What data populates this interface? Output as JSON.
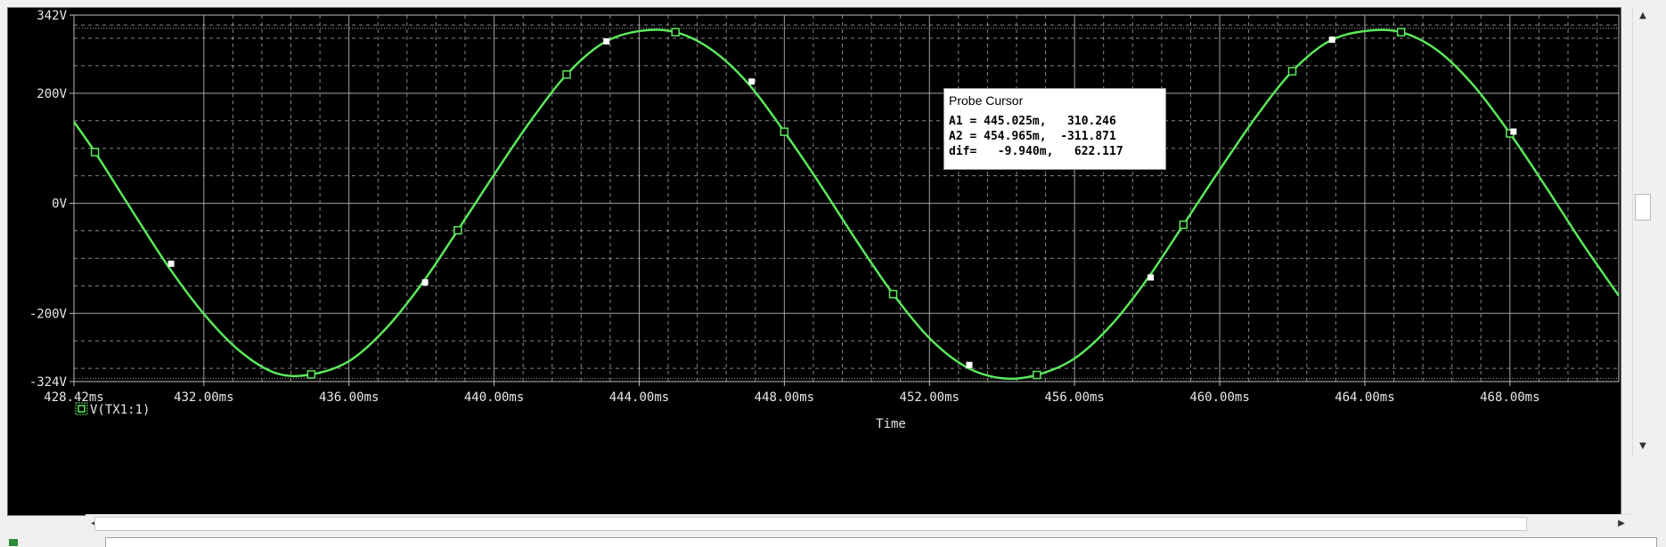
{
  "colors": {
    "background": "#000000",
    "trace": "#5be85b",
    "grid": "#bdbdbd",
    "text": "#e8e8e8"
  },
  "chart_data": {
    "type": "line",
    "title": "",
    "xlabel": "Time",
    "ylabel": "",
    "xlim": [
      428.42,
      471.0
    ],
    "ylim": [
      -324,
      342
    ],
    "x_tick_labels": [
      "428.42ms",
      "432.00ms",
      "436.00ms",
      "440.00ms",
      "444.00ms",
      "448.00ms",
      "452.00ms",
      "456.00ms",
      "460.00ms",
      "464.00ms",
      "468.00ms"
    ],
    "x_ticks": [
      428.42,
      432,
      436,
      440,
      444,
      448,
      452,
      456,
      460,
      464,
      468
    ],
    "y_tick_labels": [
      "342V",
      "200V",
      "0V",
      "-200V",
      "-324V"
    ],
    "y_ticks": [
      342,
      200,
      0,
      -200,
      -324
    ],
    "grid": true,
    "series": [
      {
        "name": "V(TX1:1)",
        "marker": "square",
        "x": [
          428.42,
          429.0,
          430.0,
          431.0,
          432.0,
          433.0,
          434.0,
          434.96,
          436.0,
          437.0,
          438.0,
          439.0,
          440.0,
          441.0,
          442.0,
          443.0,
          444.0,
          445.0,
          446.0,
          447.0,
          448.0,
          449.0,
          450.0,
          451.0,
          452.0,
          453.0,
          454.0,
          454.96,
          456.0,
          457.0,
          458.0,
          459.0,
          460.0,
          461.0,
          462.0,
          463.0,
          464.0,
          465.0,
          466.0,
          467.0,
          468.0,
          469.0,
          470.0,
          471.0
        ],
        "values": [
          148,
          93,
          -11,
          -113,
          -201,
          -269,
          -309,
          -311,
          -287,
          -229,
          -147,
          -49,
          52,
          149,
          234,
          291,
          313,
          311,
          279,
          218,
          130,
          33,
          -69,
          -165,
          -245,
          -297,
          -318,
          -312,
          -282,
          -222,
          -138,
          -39,
          61,
          157,
          240,
          294,
          313,
          311,
          278,
          214,
          127,
          29,
          -73,
          -168
        ]
      }
    ],
    "legend": {
      "entries": [
        "V(TX1:1)"
      ],
      "placement": "bottom-left"
    }
  },
  "probe_cursor": {
    "title": "Probe Cursor",
    "rows": [
      "A1 = 445.025m,   310.246",
      "A2 = 454.965m,  -311.871",
      "dif=   -9.940m,   622.117"
    ]
  },
  "scrollbar": {
    "up_arrow": "▲",
    "down_arrow": "▼",
    "left_arrow": "◀",
    "right_arrow": "▶"
  }
}
